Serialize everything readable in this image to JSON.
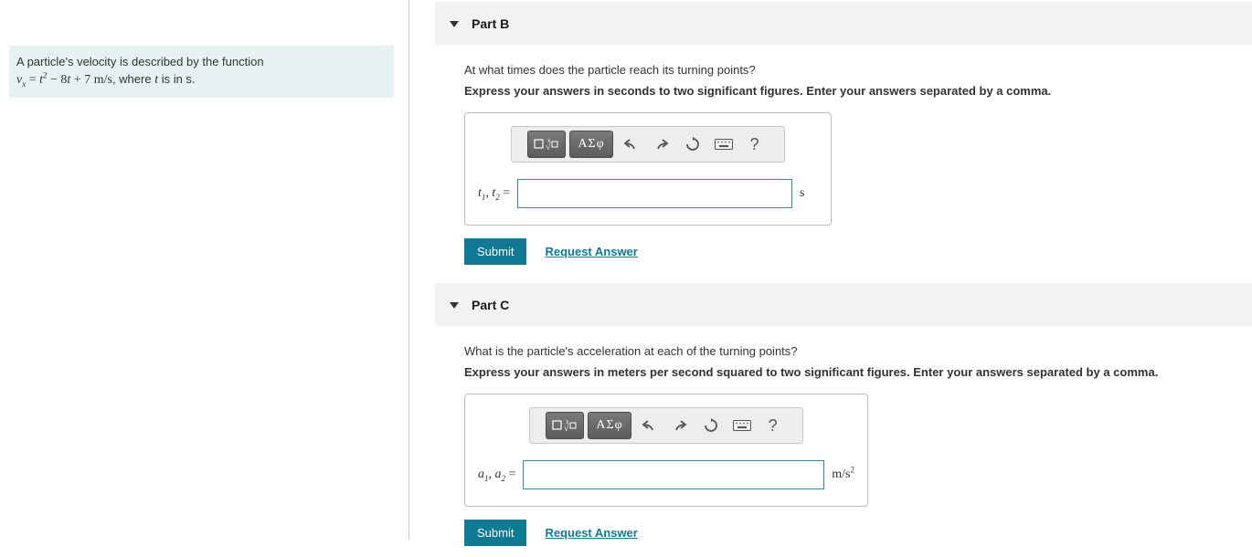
{
  "problem": {
    "line1": "A particle's velocity is described by the function",
    "vx_pre": "v",
    "vx_sub": "x",
    "eq": " = ",
    "t": "t",
    "sq": "2",
    "minus": " − 8",
    "t2": "t",
    "plus": " + 7 m/s",
    "where": ", where ",
    "t3": "t",
    "isin": " is in s."
  },
  "partB": {
    "header": "Part B",
    "question": "At what times does the particle reach its turning points?",
    "instruction": "Express your answers in seconds to two significant figures. Enter your answers separated by a comma.",
    "var_label_t1": "t",
    "var_sub1": "1",
    "comma": ", ",
    "var_label_t2": "t",
    "var_sub2": "2",
    "equals": " = ",
    "unit": "s",
    "submit": "Submit",
    "request": "Request Answer",
    "greek": "ΑΣφ",
    "help": "?"
  },
  "partC": {
    "header": "Part C",
    "question": "What is the particle's acceleration at each of the turning points?",
    "instruction": "Express your answers in meters per second squared to two significant figures. Enter your answers separated by a comma.",
    "var_label_a1": "a",
    "var_sub1": "1",
    "comma": ",  ",
    "var_label_a2": "a",
    "var_sub2": "2",
    "equals": " = ",
    "unit_pre": "m/s",
    "unit_sup": "2",
    "submit": "Submit",
    "request": "Request Answer",
    "greek": "ΑΣφ",
    "help": "?"
  }
}
